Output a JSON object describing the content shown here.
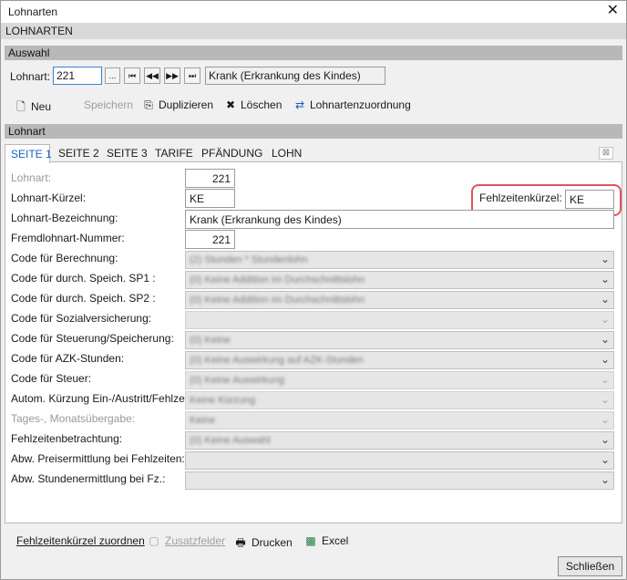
{
  "window": {
    "title": "Lohnarten",
    "close_icon": "close-icon"
  },
  "banner": "LOHNARTEN",
  "auswahl": {
    "header": "Auswahl",
    "label": "Lohnart:",
    "number": "221",
    "browse_label": "...",
    "nav": {
      "first": "|◀◀",
      "prev": "◀◀",
      "next": "▶▶",
      "last": "▶▶|"
    },
    "description": "Krank (Erkrankung des Kindes)"
  },
  "toolbar": {
    "neu": "Neu",
    "speichern": "Speichern",
    "duplizieren": "Duplizieren",
    "loeschen": "Löschen",
    "zuordnung": "Lohnartenzuordnung"
  },
  "lohnart_header": "Lohnart",
  "tabs": [
    "SEITE 1",
    "SEITE 2",
    "SEITE 3",
    "TARIFE",
    "PFÄNDUNG",
    "LOHN"
  ],
  "form": {
    "lohnart_label": "Lohnart:",
    "lohnart_value": "221",
    "kuerzel_label": "Lohnart-Kürzel:",
    "kuerzel_value": "KE",
    "fehlzeit_label": "Fehlzeitenkürzel:",
    "fehlzeit_value": "KE",
    "bezeichnung_label": "Lohnart-Bezeichnung:",
    "bezeichnung_value": "Krank (Erkrankung des Kindes)",
    "fremd_label": "Fremdlohnart-Nummer:",
    "fremd_value": "221",
    "combos": [
      {
        "label": "Code für Berechnung:",
        "value": "(2) Stunden * Stundenlohn"
      },
      {
        "label": "Code für durch. Speich. SP1 :",
        "value": "(0) Keine Addition im Durchschnittslohn"
      },
      {
        "label": "Code für durch. Speich. SP2 :",
        "value": "(0) Keine Addition im Durchschnittslohn"
      },
      {
        "label": "Code für Sozialversicherung:",
        "value": ""
      },
      {
        "label": "Code für Steuerung/Speicherung:",
        "value": "(0) Keine"
      },
      {
        "label": "Code für AZK-Stunden:",
        "value": "(0) Keine Auswirkung auf AZK-Stunden"
      },
      {
        "label": "Code für Steuer:",
        "value": "(0) Keine Auswirkung"
      },
      {
        "label": "Autom. Kürzung Ein-/Austritt/Fehlzeit:",
        "value": "Keine Kürzung"
      },
      {
        "label": "Tages-, Monatsübergabe:",
        "value": "Keine"
      },
      {
        "label": "Fehlzeitenbetrachtung:",
        "value": "(0) Keine Auswahl"
      },
      {
        "label": "Abw. Preisermittlung bei Fehlzeiten:",
        "value": ""
      },
      {
        "label": "Abw. Stundenermittlung bei Fz.:",
        "value": ""
      }
    ]
  },
  "bottom": {
    "fehlzeit_zuordnen": "Fehlzeitenkürzel zuordnen",
    "zusatzfelder": "Zusatzfelder",
    "drucken": "Drucken",
    "excel": "Excel",
    "schliessen": "Schließen"
  }
}
